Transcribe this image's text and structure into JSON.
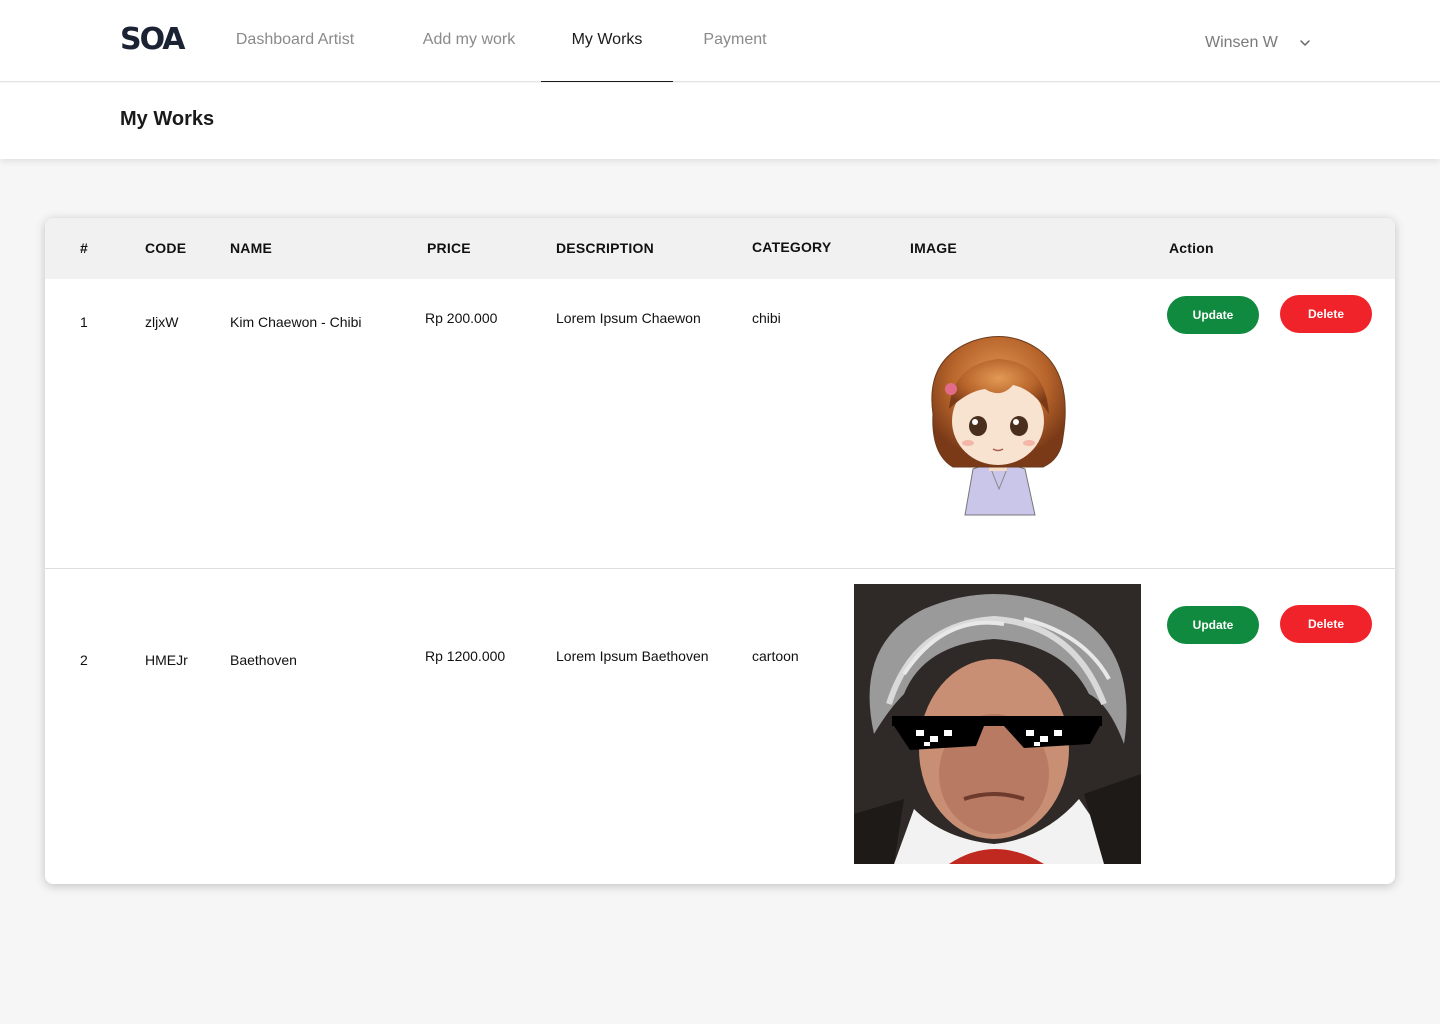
{
  "brand": {
    "logo_text": "SOA"
  },
  "nav": {
    "items": [
      {
        "label": "Dashboard Artist",
        "active": false
      },
      {
        "label": "Add my work",
        "active": false
      },
      {
        "label": "My Works",
        "active": true
      },
      {
        "label": "Payment",
        "active": false
      }
    ],
    "user": {
      "name": "Winsen W",
      "icon": "chevron-down-icon"
    }
  },
  "page": {
    "title": "My Works"
  },
  "table": {
    "headers": [
      "#",
      "CODE",
      "NAME",
      "PRICE",
      "DESCRIPTION",
      "CATEGORY",
      "IMAGE",
      "Action"
    ],
    "rows": [
      {
        "num": "1",
        "code": "zljxW",
        "name": "Kim Chaewon - Chibi",
        "price": "Rp 200.000",
        "description": "Lorem Ipsum Chaewon",
        "category": "chibi",
        "image": "chibi-girl-illustration",
        "update_label": "Update",
        "delete_label": "Delete"
      },
      {
        "num": "2",
        "code": "HMEJr",
        "name": "Baethoven",
        "price": "Rp 1200.000",
        "description": "Lorem Ipsum Baethoven",
        "category": "cartoon",
        "image": "beethoven-sunglasses-portrait",
        "update_label": "Update",
        "delete_label": "Delete"
      }
    ]
  },
  "colors": {
    "update": "#0f8a3e",
    "delete": "#f0222a",
    "header_bg": "#f1f1f1",
    "page_bg": "#f6f6f6"
  }
}
